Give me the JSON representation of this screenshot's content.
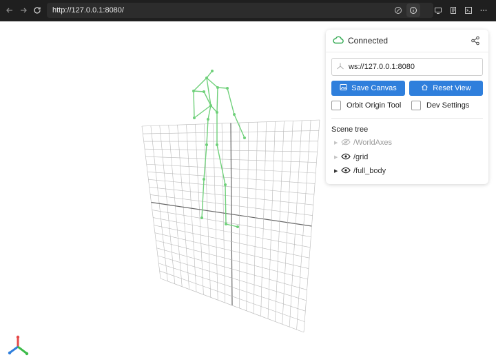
{
  "browser": {
    "url": "http://127.0.0.1:8080/",
    "icons": [
      "back-arrow-icon",
      "forward-arrow-icon",
      "reload-icon",
      "slash-circle-icon",
      "info-icon",
      "cast-icon",
      "reader-icon",
      "terminal-icon",
      "more-icon"
    ]
  },
  "panel": {
    "status": "Connected",
    "status_color": "#2fa84f",
    "ws_url": "ws://127.0.0.1:8080",
    "buttons": {
      "save": "Save Canvas",
      "reset": "Reset View"
    },
    "options": {
      "orbit": "Orbit Origin Tool",
      "dev": "Dev Settings"
    },
    "tree_title": "Scene tree",
    "tree": [
      {
        "label": "/WorldAxes",
        "visible": false
      },
      {
        "label": "/grid",
        "visible": true
      },
      {
        "label": "/full_body",
        "visible": true
      }
    ]
  },
  "colors": {
    "accent": "#2f7fdc",
    "skeleton": "#6fd07a",
    "grid": "#b9b9b9"
  }
}
